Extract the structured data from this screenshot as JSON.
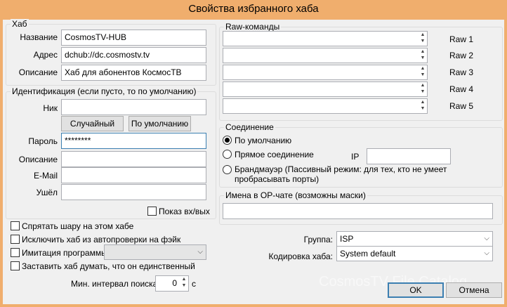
{
  "window": {
    "title": "Свойства избранного хаба"
  },
  "hub": {
    "title": "Хаб",
    "name_label": "Название",
    "name_value": "CosmosTV-HUB",
    "address_label": "Адрес",
    "address_value": "dchub://dc.cosmostv.tv",
    "description_label": "Описание",
    "description_value": "Хаб для абонентов КосмосТВ"
  },
  "identity": {
    "title": "Идентификация (если пусто, то по умолчанию)",
    "nick_label": "Ник",
    "nick_value": "",
    "random_button": "Случайный",
    "default_button": "По умолчанию",
    "password_label": "Пароль",
    "password_value": "********",
    "description_label": "Описание",
    "description_value": "",
    "email_label": "E-Mail",
    "email_value": "",
    "away_label": "Ушёл",
    "away_value": "",
    "show_checkbox": "Показ вх/вых"
  },
  "options": {
    "hide_share": "Спрятать шару на этом хабе",
    "exclude_check": "Исключить хаб из автопроверки на фэйк",
    "emulation": "Имитация программы",
    "emulation_value": "",
    "only_hub": "Заставить хаб думать, что он единственный",
    "search_interval_label": "Мин. интервал поиска",
    "search_interval_value": "0",
    "search_interval_unit": "с"
  },
  "raw": {
    "title": "Raw-команды",
    "labels": [
      "Raw 1",
      "Raw 2",
      "Raw 3",
      "Raw 4",
      "Raw 5"
    ]
  },
  "connection": {
    "title": "Соединение",
    "default": "По умолчанию",
    "direct": "Прямое соединение",
    "ip_label": "IP",
    "ip_value": "",
    "firewall": "Брандмауэр (Пассивный режим: для тех, кто не умеет пробрасывать порты)"
  },
  "op_chat": {
    "title": "Имена в OP-чате (возможны маски)",
    "value": ""
  },
  "group": {
    "label": "Группа:",
    "value": "ISP"
  },
  "encoding": {
    "label": "Кодировка хаба:",
    "value": "System default"
  },
  "buttons": {
    "ok": "OK",
    "cancel": "Отмена"
  },
  "watermark": "CosmosTV File Catalog"
}
